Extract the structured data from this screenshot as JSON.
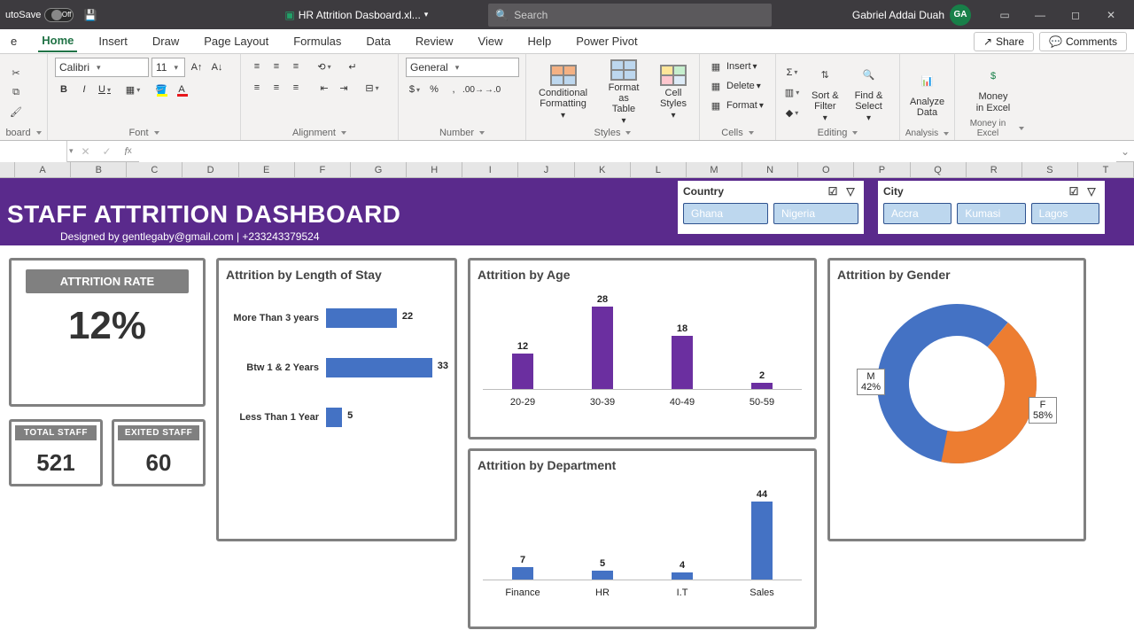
{
  "titlebar": {
    "autosave": "utoSave",
    "autosave_state": "Off",
    "filename": "HR Attrition Dasboard.xl...",
    "search_placeholder": "Search",
    "user": "Gabriel Addai Duah",
    "user_initials": "GA"
  },
  "tabs": {
    "items": [
      "e",
      "Home",
      "Insert",
      "Draw",
      "Page Layout",
      "Formulas",
      "Data",
      "Review",
      "View",
      "Help",
      "Power Pivot"
    ],
    "active": "Home",
    "share": "Share",
    "comments": "Comments"
  },
  "ribbon": {
    "clipboard": {
      "label": "board"
    },
    "font": {
      "label": "Font",
      "name": "Calibri",
      "size": "11"
    },
    "alignment": {
      "label": "Alignment"
    },
    "number": {
      "label": "Number",
      "format": "General"
    },
    "styles": {
      "label": "Styles",
      "cond": "Conditional\nFormatting",
      "table": "Format as\nTable",
      "cell": "Cell\nStyles"
    },
    "cells": {
      "label": "Cells",
      "insert": "Insert",
      "delete": "Delete",
      "format": "Format"
    },
    "editing": {
      "label": "Editing",
      "sort": "Sort &\nFilter",
      "find": "Find &\nSelect"
    },
    "analysis": {
      "label": "Analysis",
      "btn": "Analyze\nData"
    },
    "money": {
      "label": "Money in Excel",
      "btn": "Money\nin Excel"
    }
  },
  "columns": [
    "A",
    "B",
    "C",
    "D",
    "E",
    "F",
    "G",
    "H",
    "I",
    "J",
    "K",
    "L",
    "M",
    "N",
    "O",
    "P",
    "Q",
    "R",
    "S",
    "T"
  ],
  "dashboard": {
    "title": "STAFF ATTRITION DASHBOARD",
    "subtitle": "Designed by gentlegaby@gmail.com | +233243379524",
    "slicers": {
      "country": {
        "title": "Country",
        "options": [
          "Ghana",
          "Nigeria"
        ]
      },
      "city": {
        "title": "City",
        "options": [
          "Accra",
          "Kumasi",
          "Lagos"
        ]
      }
    },
    "attr_rate": {
      "label": "ATTRITION RATE",
      "value": "12%"
    },
    "total_staff": {
      "label": "TOTAL  STAFF",
      "value": "521"
    },
    "exited_staff": {
      "label": "EXITED  STAFF",
      "value": "60"
    },
    "los": {
      "title": "Attrition by Length of Stay"
    },
    "age": {
      "title": "Attrition by Age"
    },
    "dept": {
      "title": "Attrition by Department"
    },
    "gender": {
      "title": "Attrition by Gender",
      "M": "M\n42%",
      "F": "F\n58%"
    }
  },
  "chart_data": [
    {
      "type": "bar",
      "orientation": "horizontal",
      "title": "Attrition by Length of Stay",
      "categories": [
        "More Than 3 years",
        "Btw 1 & 2 Years",
        "Less Than 1 Year"
      ],
      "values": [
        22,
        33,
        5
      ],
      "xlim": [
        0,
        35
      ],
      "color": "#4472c4"
    },
    {
      "type": "bar",
      "title": "Attrition by Age",
      "categories": [
        "20-29",
        "30-39",
        "40-49",
        "50-59"
      ],
      "values": [
        12,
        28,
        18,
        2
      ],
      "ylim": [
        0,
        30
      ],
      "color": "#6b2fa0"
    },
    {
      "type": "bar",
      "title": "Attrition by Department",
      "categories": [
        "Finance",
        "HR",
        "I.T",
        "Sales"
      ],
      "values": [
        7,
        5,
        4,
        44
      ],
      "ylim": [
        0,
        50
      ],
      "color": "#4472c4"
    },
    {
      "type": "pie",
      "variant": "donut",
      "title": "Attrition by Gender",
      "series": [
        {
          "name": "M",
          "value": 42,
          "color": "#ed7d31"
        },
        {
          "name": "F",
          "value": 58,
          "color": "#4472c4"
        }
      ]
    }
  ]
}
